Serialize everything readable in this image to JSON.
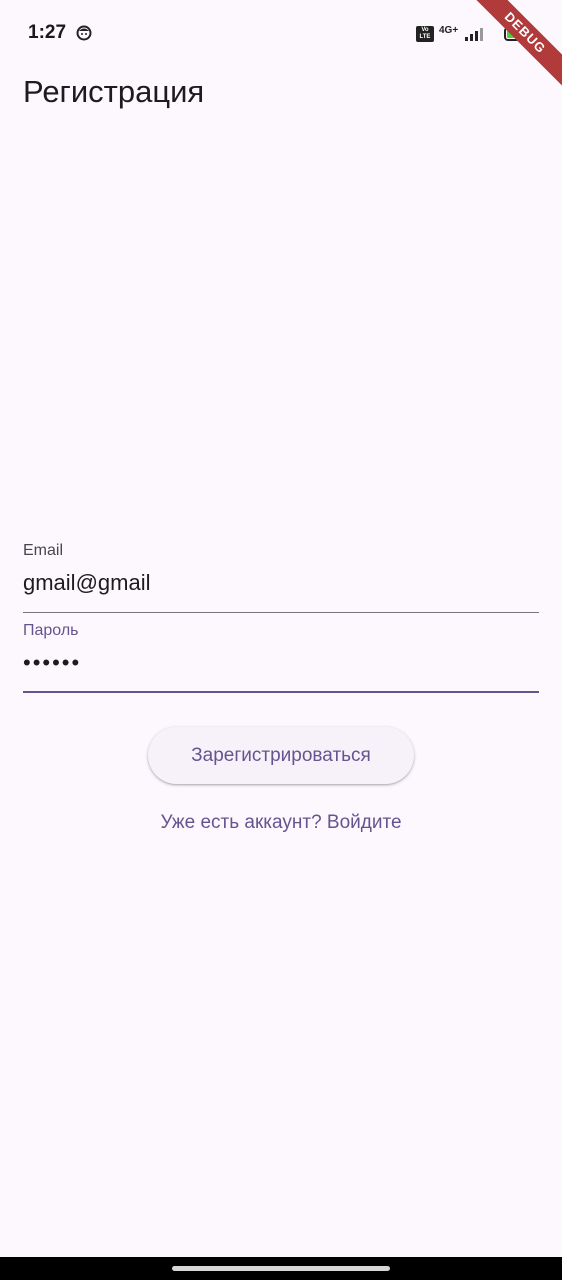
{
  "status_bar": {
    "time": "1:27",
    "volte": "Vo LTE",
    "network": "4G+",
    "battery": "59"
  },
  "debug_banner": "DEBUG",
  "header": {
    "title": "Регистрация"
  },
  "form": {
    "email": {
      "label": "Email",
      "value": "gmail@gmail"
    },
    "password": {
      "label": "Пароль",
      "value": "••••••"
    }
  },
  "actions": {
    "register_label": "Зарегистрироваться",
    "login_link": "Уже есть аккаунт? Войдите"
  },
  "colors": {
    "background": "#fdf7fe",
    "primary": "#65558f",
    "button_bg": "#f7f2fa",
    "debug": "#b13a3a"
  }
}
